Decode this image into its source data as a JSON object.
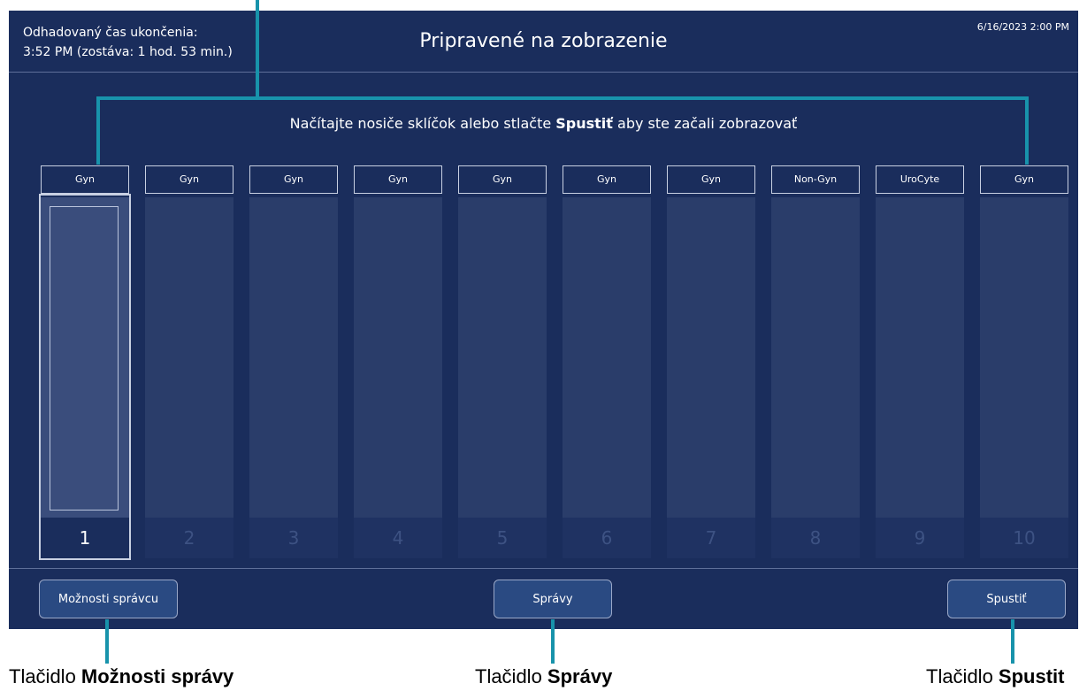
{
  "header": {
    "eta_line1": "Odhadovaný čas ukončenia:",
    "eta_line2": "3:52 PM (zostáva: 1 hod. 53 min.)",
    "title": "Pripravené na zobrazenie",
    "datetime": "6/16/2023 2:00 PM"
  },
  "instruction": {
    "pre": "Načítajte nosiče sklíčok alebo stlačte ",
    "bold": "Spustiť",
    "post": " aby ste začali zobrazovať"
  },
  "carriers": [
    {
      "label": "Gyn",
      "number": "1",
      "loaded": true
    },
    {
      "label": "Gyn",
      "number": "2",
      "loaded": false
    },
    {
      "label": "Gyn",
      "number": "3",
      "loaded": false
    },
    {
      "label": "Gyn",
      "number": "4",
      "loaded": false
    },
    {
      "label": "Gyn",
      "number": "5",
      "loaded": false
    },
    {
      "label": "Gyn",
      "number": "6",
      "loaded": false
    },
    {
      "label": "Gyn",
      "number": "7",
      "loaded": false
    },
    {
      "label": "Non-Gyn",
      "number": "8",
      "loaded": false
    },
    {
      "label": "UroCyte",
      "number": "9",
      "loaded": false
    },
    {
      "label": "Gyn",
      "number": "10",
      "loaded": false
    }
  ],
  "footer": {
    "admin_button": "Možnosti správcu",
    "messages_button": "Správy",
    "start_button": "Spustiť"
  },
  "captions": {
    "admin": {
      "prefix": "Tlačidlo ",
      "bold": "Možnosti správy"
    },
    "messages": {
      "prefix": "Tlačidlo ",
      "bold": "Správy"
    },
    "start": {
      "prefix": "Tlačidlo ",
      "bold": "Spustit"
    }
  },
  "colors": {
    "screen_bg": "#1a2d5c",
    "annotation_line": "#1893ab",
    "button_bg": "#2a4a82"
  }
}
